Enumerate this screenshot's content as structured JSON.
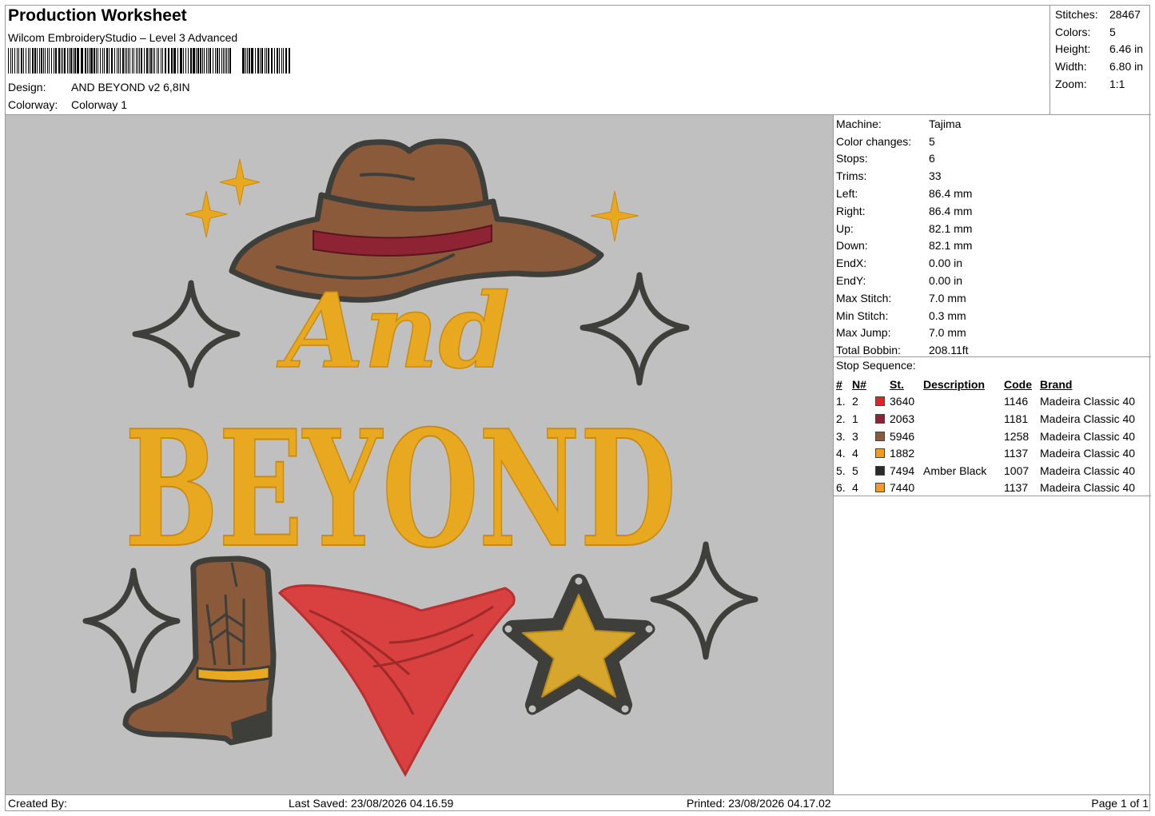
{
  "header": {
    "title": "Production Worksheet",
    "subtitle": "Wilcom EmbroideryStudio – Level 3 Advanced",
    "design_label": "Design:",
    "design_value": "AND BEYOND v2 6,8IN",
    "colorway_label": "Colorway:",
    "colorway_value": "Colorway 1"
  },
  "summary": [
    {
      "label": "Stitches:",
      "value": "28467"
    },
    {
      "label": "Colors:",
      "value": "5"
    },
    {
      "label": "Height:",
      "value": "6.46 in"
    },
    {
      "label": "Width:",
      "value": "6.80 in"
    },
    {
      "label": "Zoom:",
      "value": "1:1"
    }
  ],
  "design_text": {
    "line1": "And",
    "line2": "BEYOND"
  },
  "machine_info": [
    {
      "label": "Machine:",
      "value": "Tajima"
    },
    {
      "label": "Color changes:",
      "value": "5"
    },
    {
      "label": "Stops:",
      "value": "6"
    },
    {
      "label": "Trims:",
      "value": "33"
    },
    {
      "label": "Left:",
      "value": "86.4 mm"
    },
    {
      "label": "Right:",
      "value": "86.4 mm"
    },
    {
      "label": "Up:",
      "value": "82.1 mm"
    },
    {
      "label": "Down:",
      "value": "82.1 mm"
    },
    {
      "label": "EndX:",
      "value": "0.00 in"
    },
    {
      "label": "EndY:",
      "value": "0.00 in"
    },
    {
      "label": "Max Stitch:",
      "value": "7.0 mm"
    },
    {
      "label": "Min Stitch:",
      "value": "0.3 mm"
    },
    {
      "label": "Max Jump:",
      "value": "7.0 mm"
    },
    {
      "label": "Total Bobbin:",
      "value": "208.11ft"
    }
  ],
  "stop_sequence": {
    "title": "Stop Sequence:",
    "headers": {
      "num": "#",
      "n": "N#",
      "st": "St.",
      "description": "Description",
      "code": "Code",
      "brand": "Brand"
    },
    "rows": [
      {
        "num": "1.",
        "n": "2",
        "color": "#d42a2a",
        "st": "3640",
        "description": "",
        "code": "1146",
        "brand": "Madeira Classic 40"
      },
      {
        "num": "2.",
        "n": "1",
        "color": "#8e2333",
        "st": "2063",
        "description": "",
        "code": "1181",
        "brand": "Madeira Classic 40"
      },
      {
        "num": "3.",
        "n": "3",
        "color": "#8a5a3c",
        "st": "5946",
        "description": "",
        "code": "1258",
        "brand": "Madeira Classic 40"
      },
      {
        "num": "4.",
        "n": "4",
        "color": "#f59a1e",
        "st": "1882",
        "description": "",
        "code": "1137",
        "brand": "Madeira Classic 40"
      },
      {
        "num": "5.",
        "n": "5",
        "color": "#2a2a2a",
        "st": "7494",
        "description": "Amber Black",
        "code": "1007",
        "brand": "Madeira Classic 40"
      },
      {
        "num": "6.",
        "n": "4",
        "color": "#f59a1e",
        "st": "7440",
        "description": "",
        "code": "1137",
        "brand": "Madeira Classic 40"
      }
    ]
  },
  "footer": {
    "created_by": "Created By:",
    "last_saved": "Last Saved: 23/08/2026 04.16.59",
    "printed": "Printed: 23/08/2026 04.17.02",
    "page": "Page 1 of 1"
  }
}
